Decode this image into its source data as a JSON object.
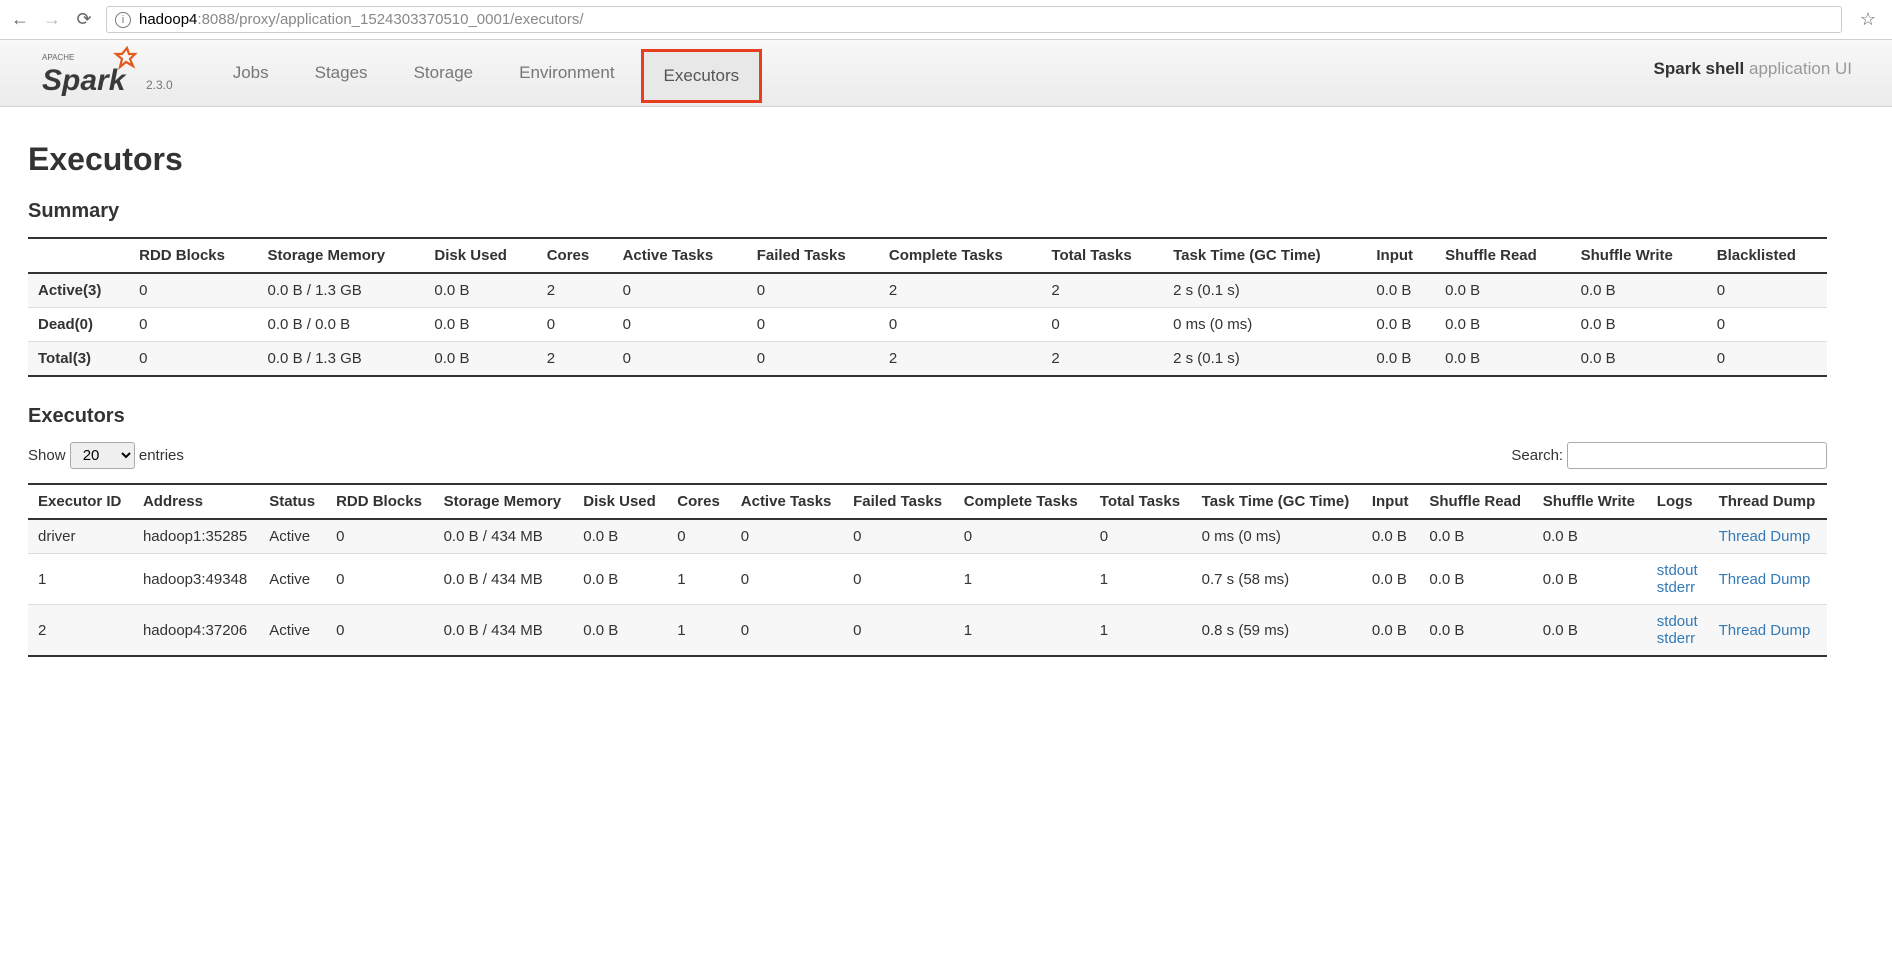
{
  "browser": {
    "url_host": "hadoop4",
    "url_rest": ":8088/proxy/application_1524303370510_0001/executors/"
  },
  "header": {
    "version": "2.3.0",
    "tabs": [
      "Jobs",
      "Stages",
      "Storage",
      "Environment",
      "Executors"
    ],
    "active_tab": "Executors",
    "app_name": "Spark shell",
    "app_suffix": " application UI"
  },
  "page_title": "Executors",
  "summary": {
    "title": "Summary",
    "columns": [
      "",
      "RDD Blocks",
      "Storage Memory",
      "Disk Used",
      "Cores",
      "Active Tasks",
      "Failed Tasks",
      "Complete Tasks",
      "Total Tasks",
      "Task Time (GC Time)",
      "Input",
      "Shuffle Read",
      "Shuffle Write",
      "Blacklisted"
    ],
    "rows": [
      {
        "label": "Active(3)",
        "rdd": "0",
        "mem": "0.0 B / 1.3 GB",
        "disk": "0.0 B",
        "cores": "2",
        "active": "0",
        "failed": "0",
        "complete": "2",
        "total": "2",
        "task": "2 s (0.1 s)",
        "input": "0.0 B",
        "sread": "0.0 B",
        "swrite": "0.0 B",
        "black": "0"
      },
      {
        "label": "Dead(0)",
        "rdd": "0",
        "mem": "0.0 B / 0.0 B",
        "disk": "0.0 B",
        "cores": "0",
        "active": "0",
        "failed": "0",
        "complete": "0",
        "total": "0",
        "task": "0 ms (0 ms)",
        "input": "0.0 B",
        "sread": "0.0 B",
        "swrite": "0.0 B",
        "black": "0"
      },
      {
        "label": "Total(3)",
        "rdd": "0",
        "mem": "0.0 B / 1.3 GB",
        "disk": "0.0 B",
        "cores": "2",
        "active": "0",
        "failed": "0",
        "complete": "2",
        "total": "2",
        "task": "2 s (0.1 s)",
        "input": "0.0 B",
        "sread": "0.0 B",
        "swrite": "0.0 B",
        "black": "0"
      }
    ]
  },
  "executors": {
    "title": "Executors",
    "show_label_pre": "Show ",
    "show_label_post": " entries",
    "page_size": "20",
    "search_label": "Search:",
    "columns": [
      "Executor ID",
      "Address",
      "Status",
      "RDD Blocks",
      "Storage Memory",
      "Disk Used",
      "Cores",
      "Active Tasks",
      "Failed Tasks",
      "Complete Tasks",
      "Total Tasks",
      "Task Time (GC Time)",
      "Input",
      "Shuffle Read",
      "Shuffle Write",
      "Logs",
      "Thread Dump"
    ],
    "rows": [
      {
        "id": "driver",
        "addr": "hadoop1:35285",
        "status": "Active",
        "rdd": "0",
        "mem": "0.0 B / 434 MB",
        "disk": "0.0 B",
        "cores": "0",
        "active": "0",
        "failed": "0",
        "complete": "0",
        "total": "0",
        "task": "0 ms (0 ms)",
        "input": "0.0 B",
        "sread": "0.0 B",
        "swrite": "0.0 B",
        "logs": [],
        "dump": "Thread Dump"
      },
      {
        "id": "1",
        "addr": "hadoop3:49348",
        "status": "Active",
        "rdd": "0",
        "mem": "0.0 B / 434 MB",
        "disk": "0.0 B",
        "cores": "1",
        "active": "0",
        "failed": "0",
        "complete": "1",
        "total": "1",
        "task": "0.7 s (58 ms)",
        "input": "0.0 B",
        "sread": "0.0 B",
        "swrite": "0.0 B",
        "logs": [
          "stdout",
          "stderr"
        ],
        "dump": "Thread Dump"
      },
      {
        "id": "2",
        "addr": "hadoop4:37206",
        "status": "Active",
        "rdd": "0",
        "mem": "0.0 B / 434 MB",
        "disk": "0.0 B",
        "cores": "1",
        "active": "0",
        "failed": "0",
        "complete": "1",
        "total": "1",
        "task": "0.8 s (59 ms)",
        "input": "0.0 B",
        "sread": "0.0 B",
        "swrite": "0.0 B",
        "logs": [
          "stdout",
          "stderr"
        ],
        "dump": "Thread Dump"
      }
    ]
  }
}
